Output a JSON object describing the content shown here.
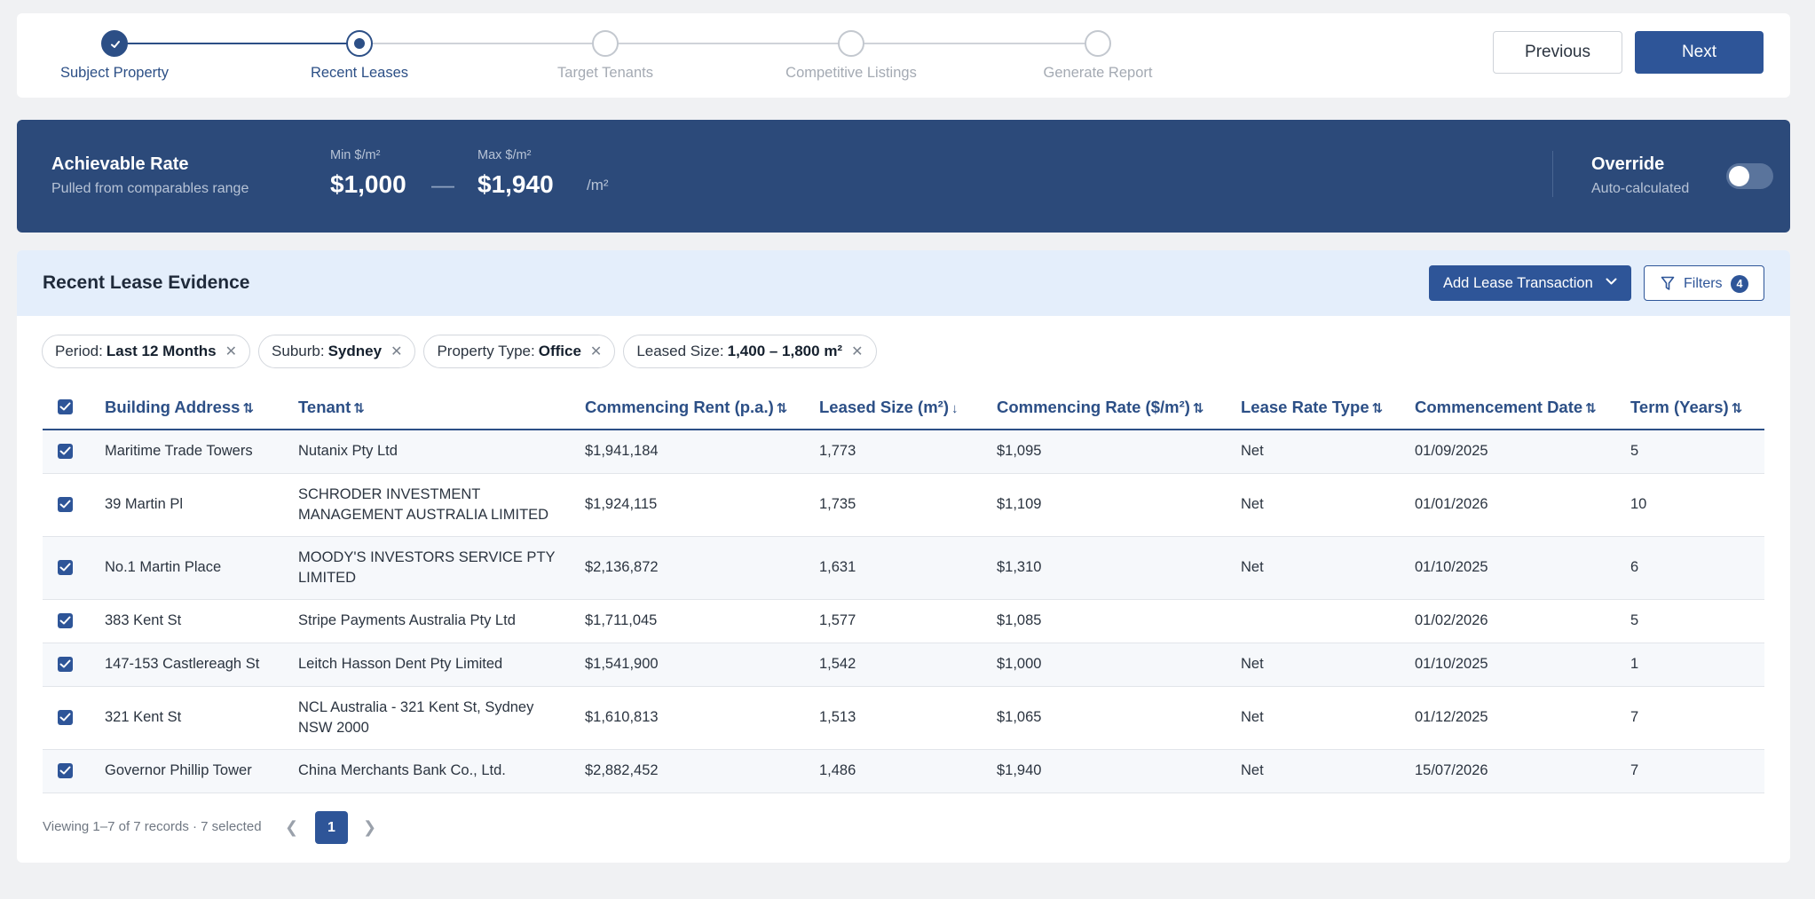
{
  "stepper": {
    "steps": [
      {
        "label": "Subject Property",
        "state": "done"
      },
      {
        "label": "Recent Leases",
        "state": "current"
      },
      {
        "label": "Target Tenants",
        "state": "todo"
      },
      {
        "label": "Competitive Listings",
        "state": "todo"
      },
      {
        "label": "Generate Report",
        "state": "todo"
      }
    ],
    "previous_label": "Previous",
    "next_label": "Next"
  },
  "rate": {
    "title": "Achievable Rate",
    "subtitle": "Pulled from comparables range",
    "min_label": "Min $/m²",
    "min_value": "$1,000",
    "separator": "—",
    "max_label": "Max $/m²",
    "max_value": "$1,940",
    "unit": "/m²",
    "override_title": "Override",
    "override_subtitle": "Auto-calculated",
    "override_on": false
  },
  "evidence": {
    "title": "Recent Lease Evidence",
    "add_label": "Add Lease Transaction",
    "filters_label": "Filters",
    "filters_count": "4",
    "chips": [
      {
        "key": "Period:",
        "value": "Last 12 Months"
      },
      {
        "key": "Suburb:",
        "value": "Sydney"
      },
      {
        "key": "Property Type:",
        "value": "Office"
      },
      {
        "key": "Leased Size:",
        "value": "1,400 – 1,800 m²"
      }
    ],
    "columns": [
      {
        "label": "Building Address",
        "sort": "⇅"
      },
      {
        "label": "Tenant",
        "sort": "⇅"
      },
      {
        "label": "Commencing Rent (p.a.)",
        "sort": "⇅"
      },
      {
        "label": "Leased Size (m²)",
        "sort": "↓"
      },
      {
        "label": "Commencing Rate ($/m²)",
        "sort": "⇅"
      },
      {
        "label": "Lease Rate Type",
        "sort": "⇅"
      },
      {
        "label": "Commencement Date",
        "sort": "⇅"
      },
      {
        "label": "Term (Years)",
        "sort": "⇅"
      }
    ],
    "rows": [
      {
        "address": "Maritime Trade Towers",
        "tenant": "Nutanix Pty Ltd",
        "rent": "$1,941,184",
        "size": "1,773",
        "rate": "$1,095",
        "type": "Net",
        "date": "01/09/2025",
        "term": "5"
      },
      {
        "address": "39 Martin Pl",
        "tenant": "SCHRODER INVESTMENT MANAGEMENT AUSTRALIA LIMITED",
        "rent": "$1,924,115",
        "size": "1,735",
        "rate": "$1,109",
        "type": "Net",
        "date": "01/01/2026",
        "term": "10"
      },
      {
        "address": "No.1 Martin Place",
        "tenant": "MOODY'S INVESTORS SERVICE PTY LIMITED",
        "rent": "$2,136,872",
        "size": "1,631",
        "rate": "$1,310",
        "type": "Net",
        "date": "01/10/2025",
        "term": "6"
      },
      {
        "address": "383 Kent St",
        "tenant": "Stripe Payments Australia Pty Ltd",
        "rent": "$1,711,045",
        "size": "1,577",
        "rate": "$1,085",
        "type": "",
        "date": "01/02/2026",
        "term": "5"
      },
      {
        "address": "147-153 Castlereagh St",
        "tenant": "Leitch Hasson Dent Pty Limited",
        "rent": "$1,541,900",
        "size": "1,542",
        "rate": "$1,000",
        "type": "Net",
        "date": "01/10/2025",
        "term": "1"
      },
      {
        "address": "321 Kent St",
        "tenant": "NCL Australia - 321 Kent St, Sydney NSW 2000",
        "rent": "$1,610,813",
        "size": "1,513",
        "rate": "$1,065",
        "type": "Net",
        "date": "01/12/2025",
        "term": "7"
      },
      {
        "address": "Governor Phillip Tower",
        "tenant": "China Merchants Bank Co., Ltd.",
        "rent": "$2,882,452",
        "size": "1,486",
        "rate": "$1,940",
        "type": "Net",
        "date": "15/07/2026",
        "term": "7"
      }
    ],
    "footer_text": "Viewing 1–7 of 7 records · 7 selected",
    "page": "1"
  },
  "colors": {
    "primary": "#2e5598",
    "banner": "#2c4a7a",
    "header_bg": "#e4eefb"
  }
}
